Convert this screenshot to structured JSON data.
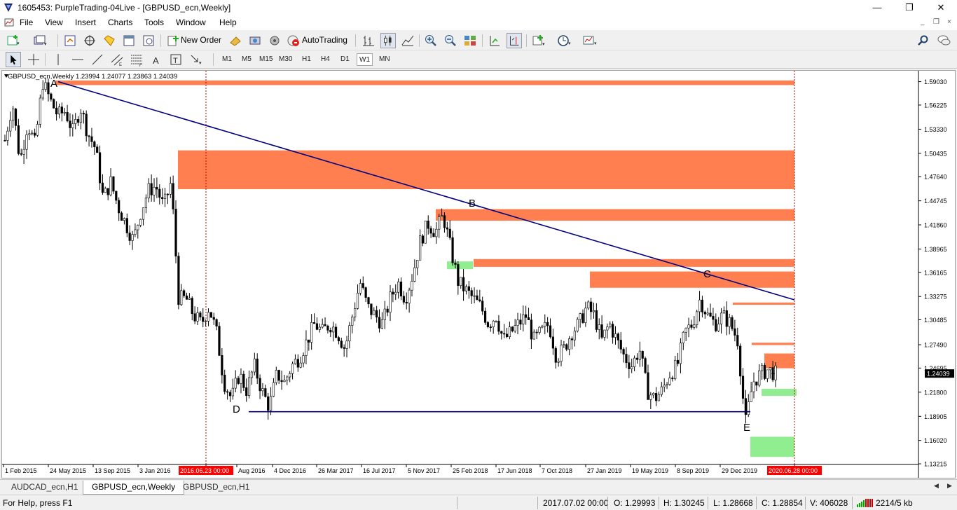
{
  "window": {
    "title": "1605453: PurpleTrading-04Live - [GBPUSD_ecn,Weekly]",
    "controls": [
      "—",
      "❐",
      "✕"
    ]
  },
  "menu": {
    "items": [
      "File",
      "View",
      "Insert",
      "Charts",
      "Tools",
      "Window",
      "Help"
    ],
    "mdi_controls": [
      "_",
      "❐",
      "×"
    ]
  },
  "toolbar": {
    "new_order_label": "New Order",
    "autotrading_label": "AutoTrading",
    "icons": [
      "new-chart-icon",
      "profiles-icon",
      "market-watch-icon",
      "navigator-icon",
      "data-window-icon",
      "terminal-icon",
      "strategy-tester-icon",
      "new-order-icon",
      "metaeditor-icon",
      "signals-icon",
      "market-icon",
      "autotrading-icon",
      "bar-chart-icon",
      "candlestick-icon",
      "line-chart-icon",
      "zoom-in-icon",
      "zoom-out-icon",
      "tile-windows-icon",
      "autoscroll-icon",
      "chart-shift-icon",
      "indicators-icon",
      "periods-icon",
      "templates-icon",
      "search-icon",
      "chat-icon"
    ]
  },
  "drawing_tools": {
    "icons": [
      "cursor-icon",
      "crosshair-icon",
      "vertical-line-icon",
      "horizontal-line-icon",
      "trendline-icon",
      "equidistant-channel-icon",
      "fibonacci-icon",
      "text-icon",
      "text-label-icon",
      "arrows-icon"
    ]
  },
  "timeframes": {
    "items": [
      "M1",
      "M5",
      "M15",
      "M30",
      "H1",
      "H4",
      "D1",
      "W1",
      "MN"
    ],
    "active": "W1"
  },
  "chart": {
    "symbol_info": "GBPUSD_ecn,Weekly  1.23994 1.24077 1.23863 1.24039",
    "current_price": "1.24039",
    "colors": {
      "zone_red": "#ff7f50",
      "zone_green": "#90ee90",
      "trendline": "#000080",
      "period_sep": "#c00000",
      "highlight_label": "#ff0000"
    }
  },
  "chart_data": {
    "type": "candlestick",
    "symbol": "GBPUSD_ecn",
    "timeframe": "Weekly",
    "last_bar": {
      "open": 1.23994,
      "high": 1.24077,
      "low": 1.23863,
      "close": 1.24039
    },
    "y_ticks": [
      1.5903,
      1.56225,
      1.5333,
      1.50435,
      1.4764,
      1.44745,
      1.4186,
      1.38965,
      1.36165,
      1.33275,
      1.30485,
      1.2749,
      1.24695,
      1.218,
      1.18905,
      1.1602,
      1.13215
    ],
    "y_tick_labels": [
      "1.59030",
      "1.56225",
      "1.53330",
      "1.50435",
      "1.47640",
      "1.44745",
      "1.41860",
      "1.38965",
      "1.36165",
      "1.33275",
      "1.30485",
      "1.27490",
      "1.24695",
      "1.21800",
      "1.18905",
      "1.16020",
      "1.13215"
    ],
    "ylim": [
      1.128,
      1.6
    ],
    "x_tick_labels": [
      "1 Feb 2015",
      "24 May 2015",
      "13 Sep 2015",
      "3 Jan 2016",
      "2016.06.23 00:00",
      "Aug 2016",
      "4 Dec 2016",
      "26 Mar 2017",
      "16 Jul 2017",
      "5 Nov 2017",
      "25 Feb 2018",
      "17 Jun 2018",
      "7 Oct 2018",
      "27 Jan 2019",
      "19 May 2019",
      "8 Sep 2019",
      "29 Dec 2019",
      "2020.06.28 00:00"
    ],
    "x_highlighted": [
      "2016.06.23 00:00",
      "2020.06.28 00:00"
    ],
    "point_labels": [
      {
        "label": "A",
        "price": 1.5903
      },
      {
        "label": "B",
        "price": 1.4376
      },
      {
        "label": "C",
        "price": 1.3515
      },
      {
        "label": "D",
        "price": 1.1946
      },
      {
        "label": "E",
        "price": 1.1409
      }
    ],
    "red_zones": [
      {
        "top": 1.5917,
        "bottom": 1.5862
      },
      {
        "top": 1.5079,
        "bottom": 1.4614
      },
      {
        "top": 1.4375,
        "bottom": 1.4236
      },
      {
        "top": 1.3776,
        "bottom": 1.3683
      },
      {
        "top": 1.3627,
        "bottom": 1.3432
      },
      {
        "top": 1.3255,
        "bottom": 1.3228
      },
      {
        "top": 1.2773,
        "bottom": 1.2745
      },
      {
        "top": 1.2644,
        "bottom": 1.2467
      }
    ],
    "green_zones": [
      {
        "top": 1.3748,
        "bottom": 1.3655
      },
      {
        "top": 1.222,
        "bottom": 1.2136
      },
      {
        "top": 1.1646,
        "bottom": 1.1404
      }
    ],
    "lines": [
      {
        "name": "trendline-a-c",
        "from_price": 1.5903,
        "to_price": 1.3287
      },
      {
        "name": "support-d-e",
        "price": 1.1946
      }
    ],
    "series_path": [
      1.52,
      1.565,
      1.495,
      1.54,
      1.515,
      1.59,
      1.568,
      1.55,
      1.555,
      1.53,
      1.56,
      1.528,
      1.51,
      1.45,
      1.47,
      1.44,
      1.42,
      1.4,
      1.435,
      1.46,
      1.465,
      1.44,
      1.47,
      1.33,
      1.33,
      1.31,
      1.3,
      1.32,
      1.29,
      1.23,
      1.21,
      1.24,
      1.22,
      1.25,
      1.22,
      1.2,
      1.24,
      1.23,
      1.25,
      1.26,
      1.28,
      1.3,
      1.29,
      1.3,
      1.29,
      1.27,
      1.31,
      1.35,
      1.32,
      1.31,
      1.3,
      1.33,
      1.35,
      1.33,
      1.36,
      1.4,
      1.42,
      1.41,
      1.43,
      1.39,
      1.35,
      1.34,
      1.33,
      1.32,
      1.3,
      1.31,
      1.28,
      1.29,
      1.3,
      1.31,
      1.28,
      1.29,
      1.3,
      1.26,
      1.27,
      1.29,
      1.3,
      1.32,
      1.31,
      1.28,
      1.3,
      1.28,
      1.26,
      1.25,
      1.27,
      1.22,
      1.21,
      1.22,
      1.24,
      1.25,
      1.29,
      1.3,
      1.33,
      1.31,
      1.3,
      1.31,
      1.3,
      1.28,
      1.18,
      1.23,
      1.24,
      1.245,
      1.24
    ]
  },
  "tabs": [
    "AUDCAD_ecn,H1",
    "GBPUSD_ecn,Weekly",
    "GBPUSD_ecn,H1"
  ],
  "active_tab": "GBPUSD_ecn,Weekly",
  "status": {
    "help": "For Help, press F1",
    "datetime": "2017.07.02 00:00",
    "open": "O: 1.29993",
    "high": "H: 1.30245",
    "low": "L: 1.28668",
    "close": "C: 1.28854",
    "volume": "V: 406028",
    "traffic": "2214/5 kb"
  }
}
